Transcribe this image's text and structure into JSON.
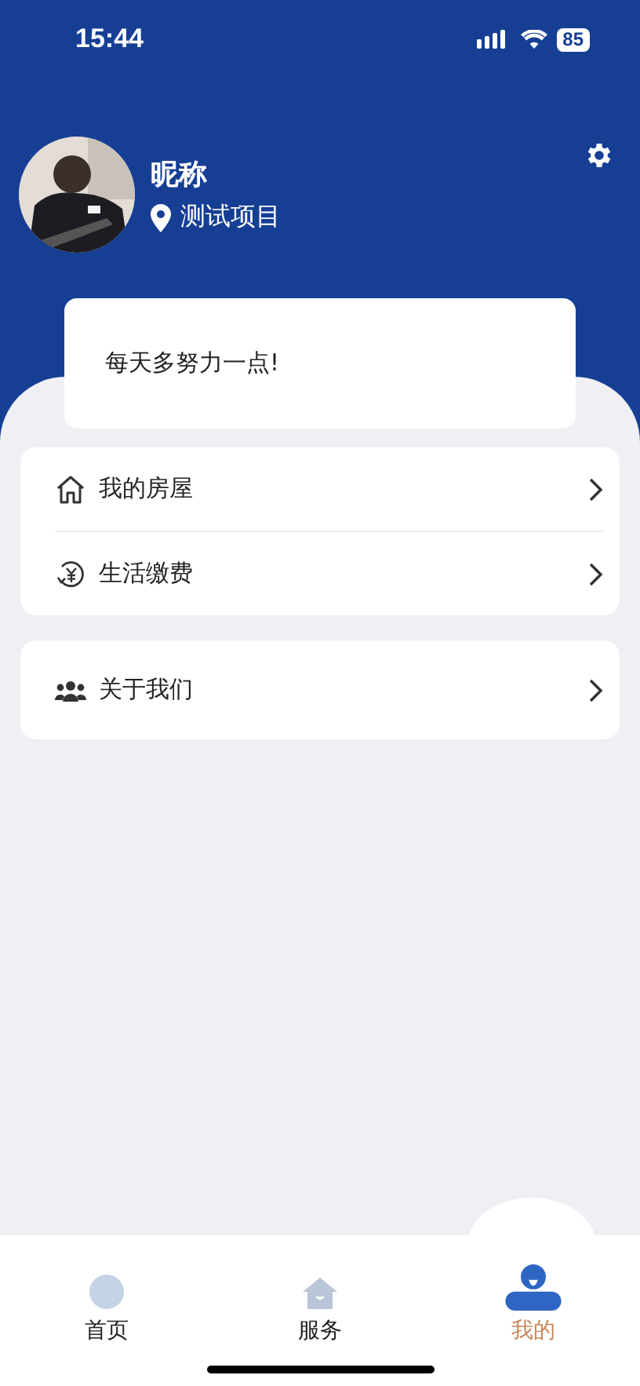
{
  "status_bar": {
    "time": "15:44",
    "battery": "85"
  },
  "profile": {
    "nickname": "昵称",
    "project": "测试项目"
  },
  "motto": "每天多努力一点!",
  "menu_groups": [
    [
      {
        "kind": "house",
        "label": "我的房屋"
      },
      {
        "kind": "payment",
        "label": "生活缴费"
      }
    ],
    [
      {
        "kind": "people",
        "label": "关于我们"
      }
    ]
  ],
  "tabs": [
    {
      "kind": "home",
      "label": "首页",
      "selected": false
    },
    {
      "kind": "service",
      "label": "服务",
      "selected": false
    },
    {
      "kind": "me",
      "label": "我的",
      "selected": true
    }
  ]
}
